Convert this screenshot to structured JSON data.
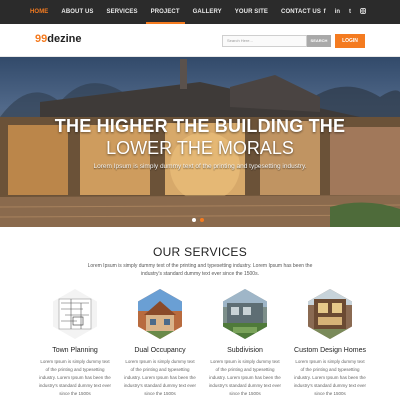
{
  "nav": {
    "items": [
      "HOME",
      "ABOUT US",
      "SERVICES",
      "PROJECT",
      "GALLERY",
      "YOUR SITE",
      "CONTACT US"
    ],
    "social": [
      "f",
      "in",
      "t",
      "ig"
    ]
  },
  "header": {
    "logo_num": "99",
    "logo_text": "dezine",
    "search_placeholder": "Search Here...",
    "search_label": "SEARCH",
    "login_label": "LOGIN"
  },
  "hero": {
    "title": "THE HIGHER THE BUILDING THE",
    "subtitle": "LOWER THE MORALS",
    "text": "Lorem Ipsum is simply dummy text of the printing and typesetting industry."
  },
  "services": {
    "title": "OUR SERVICES",
    "intro": "Lorem Ipsum is simply dummy text of the printing and typesetting industry. Lorem Ipsum has been the industry's standard dummy text ever since the 1500s.",
    "items": [
      {
        "title": "Town Planning",
        "text": "Lorem Ipsum is simply dummy text of the printing and typesetting industry. Lorem Ipsum has been the industry's standard dummy text ever since the 1500s"
      },
      {
        "title": "Dual Occupancy",
        "text": "Lorem Ipsum is simply dummy text of the printing and typesetting industry. Lorem Ipsum has been the industry's standard dummy text ever since the 1500s"
      },
      {
        "title": "Subdivision",
        "text": "Lorem Ipsum is simply dummy text of the printing and typesetting industry. Lorem Ipsum has been the industry's standard dummy text ever since the 1500s"
      },
      {
        "title": "Custom Design Homes",
        "text": "Lorem Ipsum is simply dummy text of the printing and typesetting industry. Lorem Ipsum has been the industry's standard dummy text ever since the 1500s"
      }
    ]
  },
  "colors": {
    "accent": "#f47b20",
    "nav_bg": "#2b2b2b"
  }
}
